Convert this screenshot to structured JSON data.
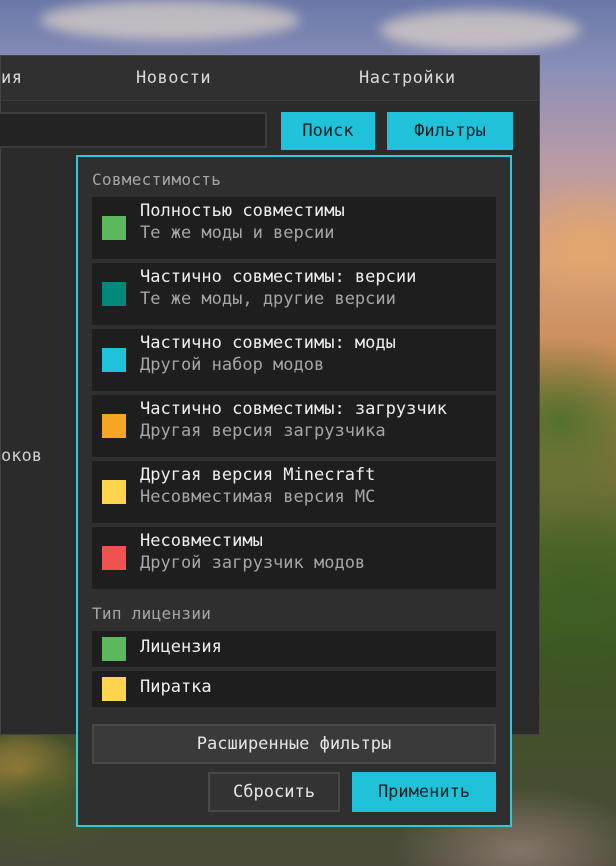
{
  "nav": {
    "items": [
      {
        "label": "ия"
      },
      {
        "label": "Новости"
      },
      {
        "label": "Настройки"
      }
    ]
  },
  "toolbar": {
    "search_value": "",
    "search_button": "Поиск",
    "filters_button": "Фильтры"
  },
  "sidebar": {
    "fragment": "оков"
  },
  "filters": {
    "compat_title": "Совместимость",
    "compat_items": [
      {
        "title": "Полностью совместимы",
        "subtitle": "Те же моды и версии",
        "color": "#5cb85c"
      },
      {
        "title": "Частично совместимы: версии",
        "subtitle": "Те же моды, другие версии",
        "color": "#00897b"
      },
      {
        "title": "Частично совместимы: моды",
        "subtitle": "Другой набор модов",
        "color": "#1fc2d8"
      },
      {
        "title": "Частично совместимы: загрузчик",
        "subtitle": "Другая версия загрузчика",
        "color": "#f5a623"
      },
      {
        "title": "Другая версия Minecraft",
        "subtitle": "Несовместимая версия MC",
        "color": "#ffd54f"
      },
      {
        "title": "Несовместимы",
        "subtitle": "Другой загрузчик модов",
        "color": "#ef5350"
      }
    ],
    "license_title": "Тип лицензии",
    "license_items": [
      {
        "title": "Лицензия",
        "color": "#5cb85c"
      },
      {
        "title": "Пиратка",
        "color": "#ffd54f"
      }
    ],
    "advanced_button": "Расширенные фильтры",
    "reset_button": "Сбросить",
    "apply_button": "Применить"
  }
}
